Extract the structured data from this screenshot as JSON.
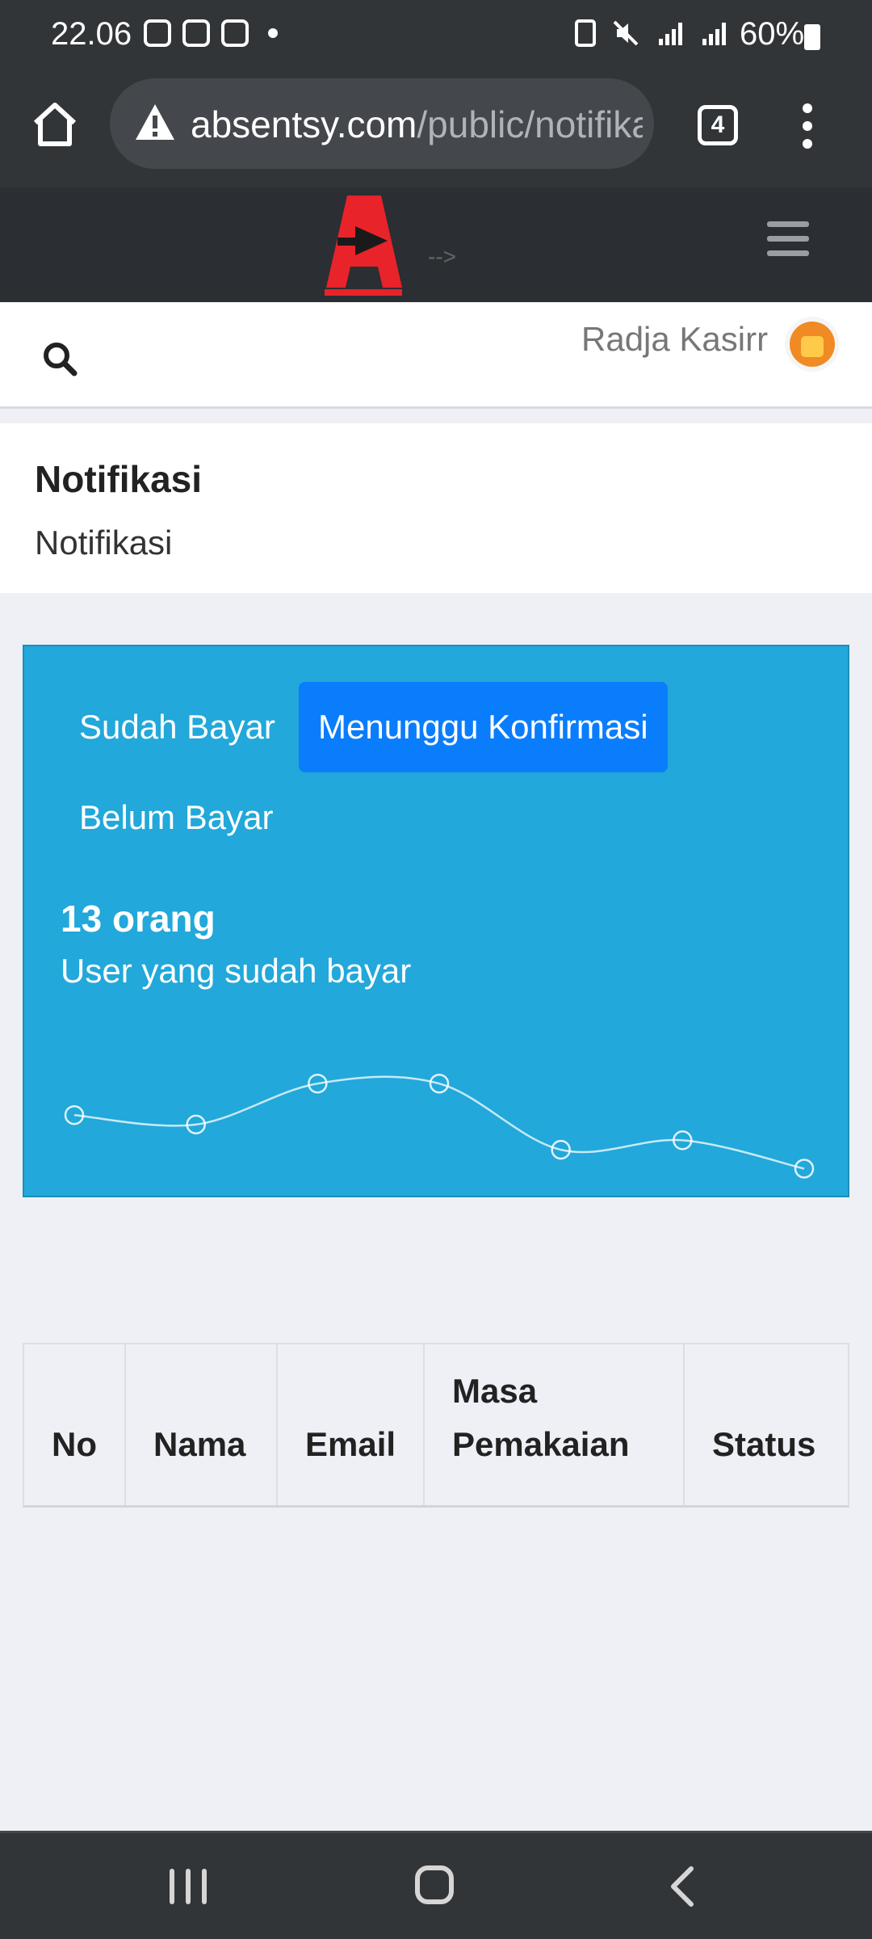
{
  "status_bar": {
    "time": "22.06",
    "battery": "60%"
  },
  "browser": {
    "url_host": "absentsy.com",
    "url_path": "/public/notifikasi",
    "tab_count": "4"
  },
  "header": {
    "logo_arrow_text": "-->"
  },
  "user_bar": {
    "user_name": "Radja Kasirr"
  },
  "page": {
    "title": "Notifikasi",
    "subtitle": "Notifikasi"
  },
  "card": {
    "tabs": [
      {
        "label": "Sudah Bayar",
        "active": false
      },
      {
        "label": "Menunggu Konfirmasi",
        "active": true
      },
      {
        "label": "Belum Bayar",
        "active": false
      }
    ],
    "stat_count": "13 orang",
    "stat_label": "User yang sudah bayar",
    "accent_color": "#22a8da",
    "active_tab_color": "#0a7dfc"
  },
  "chart_data": {
    "type": "line",
    "x": [
      1,
      2,
      3,
      4,
      5,
      6,
      7
    ],
    "values": [
      2.2,
      1.9,
      3.2,
      3.2,
      1.1,
      1.4,
      0.5
    ],
    "ylim": [
      0,
      4
    ],
    "grid": false
  },
  "table": {
    "headers": [
      "No",
      "Nama",
      "Email",
      "Masa Pemakaian",
      "Status"
    ],
    "rows": []
  },
  "nav_bar": {
    "icons": [
      "recent-apps-icon",
      "home-icon",
      "back-icon"
    ]
  }
}
